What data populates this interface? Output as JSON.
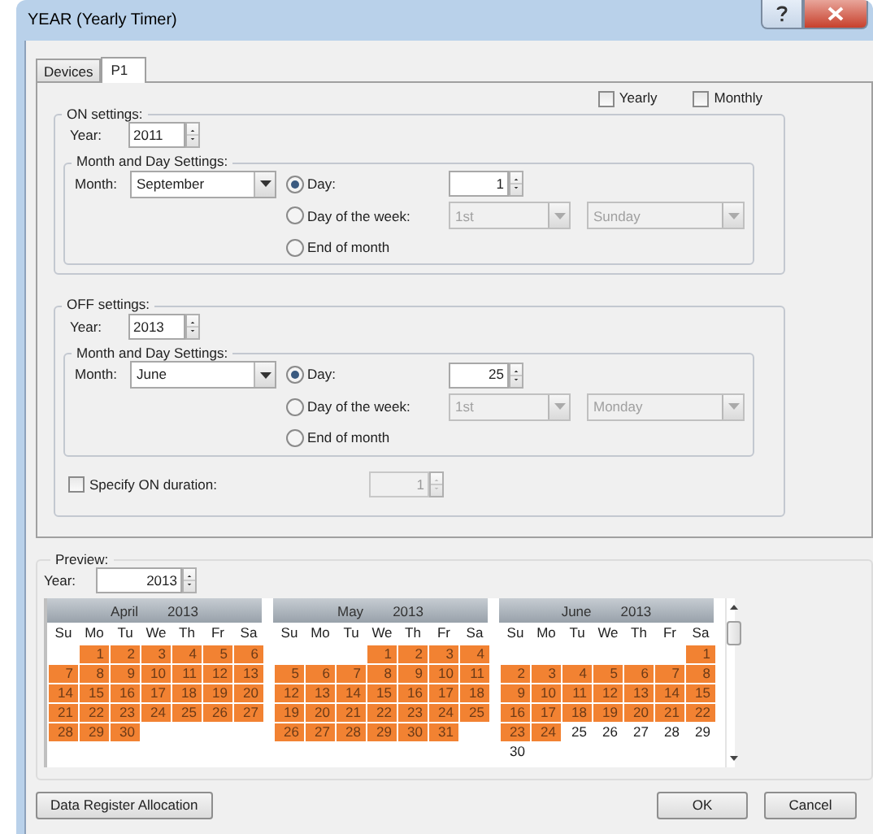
{
  "window": {
    "title": "YEAR (Yearly Timer)"
  },
  "tabs": [
    {
      "label": "Devices",
      "selected": false
    },
    {
      "label": "P1",
      "selected": true
    }
  ],
  "options": [
    {
      "label": "Yearly",
      "checked": false
    },
    {
      "label": "Monthly",
      "checked": false
    }
  ],
  "settings": [
    {
      "title": "ON settings:",
      "year_label": "Year:",
      "year": "2011",
      "group_title": "Month and Day Settings:",
      "month_label": "Month:",
      "month": "September",
      "modes": [
        {
          "label": "Day:",
          "selected": true
        },
        {
          "label": "Day of the week:",
          "selected": false
        },
        {
          "label": "End of month",
          "selected": false
        }
      ],
      "day": {
        "value": "1",
        "disabled": false
      },
      "week": {
        "value": "1st",
        "disabled": true
      },
      "weekday": {
        "value": "Sunday",
        "disabled": true
      }
    },
    {
      "title": "OFF settings:",
      "year_label": "Year:",
      "year": "2013",
      "group_title": "Month and Day Settings:",
      "month_label": "Month:",
      "month": "June",
      "modes": [
        {
          "label": "Day:",
          "selected": true
        },
        {
          "label": "Day of the week:",
          "selected": false
        },
        {
          "label": "End of month",
          "selected": false
        }
      ],
      "day": {
        "value": "25",
        "disabled": false
      },
      "week": {
        "value": "1st",
        "disabled": true
      },
      "weekday": {
        "value": "Monday",
        "disabled": true
      },
      "duration": {
        "label": "Specify ON duration:",
        "checked": false,
        "value": "1",
        "disabled": true
      }
    }
  ],
  "preview": {
    "title": "Preview:",
    "year_label": "Year:",
    "year": "2013",
    "calendars": [
      {
        "month": "April",
        "year": "2013",
        "weekdays": [
          "Su",
          "Mo",
          "Tu",
          "We",
          "Th",
          "Fr",
          "Sa"
        ],
        "weeks": [
          [
            {
              "kind": "empty"
            },
            {
              "kind": "day",
              "d": "1",
              "marked": true
            },
            {
              "d": "2",
              "marked": true
            },
            {
              "d": "3",
              "marked": true
            },
            {
              "d": "4",
              "marked": true
            },
            {
              "d": "5",
              "marked": true
            },
            {
              "d": "6",
              "marked": true
            }
          ],
          [
            {
              "d": "7",
              "marked": true
            },
            {
              "d": "8",
              "marked": true
            },
            {
              "d": "9",
              "marked": true
            },
            {
              "d": "10",
              "marked": true
            },
            {
              "d": "11",
              "marked": true
            },
            {
              "d": "12",
              "marked": true
            },
            {
              "d": "13",
              "marked": true
            }
          ],
          [
            {
              "d": "14",
              "marked": true
            },
            {
              "d": "15",
              "marked": true
            },
            {
              "d": "16",
              "marked": true
            },
            {
              "d": "17",
              "marked": true
            },
            {
              "d": "18",
              "marked": true
            },
            {
              "d": "19",
              "marked": true
            },
            {
              "d": "20",
              "marked": true
            }
          ],
          [
            {
              "d": "21",
              "marked": true
            },
            {
              "d": "22",
              "marked": true
            },
            {
              "d": "23",
              "marked": true
            },
            {
              "d": "24",
              "marked": true
            },
            {
              "d": "25",
              "marked": true
            },
            {
              "d": "26",
              "marked": true
            },
            {
              "d": "27",
              "marked": true
            }
          ],
          [
            {
              "d": "28",
              "marked": true
            },
            {
              "d": "29",
              "marked": true
            },
            {
              "d": "30",
              "marked": true
            }
          ]
        ]
      },
      {
        "month": "May",
        "year": "2013",
        "weekdays": [
          "Su",
          "Mo",
          "Tu",
          "We",
          "Th",
          "Fr",
          "Sa"
        ],
        "weeks": [
          [
            {
              "kind": "empty"
            },
            {
              "kind": "empty"
            },
            {
              "kind": "empty"
            },
            {
              "d": "1",
              "marked": true
            },
            {
              "d": "2",
              "marked": true
            },
            {
              "d": "3",
              "marked": true
            },
            {
              "d": "4",
              "marked": true
            }
          ],
          [
            {
              "d": "5",
              "marked": true
            },
            {
              "d": "6",
              "marked": true
            },
            {
              "d": "7",
              "marked": true
            },
            {
              "d": "8",
              "marked": true
            },
            {
              "d": "9",
              "marked": true
            },
            {
              "d": "10",
              "marked": true
            },
            {
              "d": "11",
              "marked": true
            }
          ],
          [
            {
              "d": "12",
              "marked": true
            },
            {
              "d": "13",
              "marked": true
            },
            {
              "d": "14",
              "marked": true
            },
            {
              "d": "15",
              "marked": true
            },
            {
              "d": "16",
              "marked": true
            },
            {
              "d": "17",
              "marked": true
            },
            {
              "d": "18",
              "marked": true
            }
          ],
          [
            {
              "d": "19",
              "marked": true
            },
            {
              "d": "20",
              "marked": true
            },
            {
              "d": "21",
              "marked": true
            },
            {
              "d": "22",
              "marked": true
            },
            {
              "d": "23",
              "marked": true
            },
            {
              "d": "24",
              "marked": true
            },
            {
              "d": "25",
              "marked": true
            }
          ],
          [
            {
              "d": "26",
              "marked": true
            },
            {
              "d": "27",
              "marked": true
            },
            {
              "d": "28",
              "marked": true
            },
            {
              "d": "29",
              "marked": true
            },
            {
              "d": "30",
              "marked": true
            },
            {
              "d": "31",
              "marked": true
            }
          ]
        ]
      },
      {
        "month": "June",
        "year": "2013",
        "weekdays": [
          "Su",
          "Mo",
          "Tu",
          "We",
          "Th",
          "Fr",
          "Sa"
        ],
        "weeks": [
          [
            {
              "kind": "empty"
            },
            {
              "kind": "empty"
            },
            {
              "kind": "empty"
            },
            {
              "kind": "empty"
            },
            {
              "kind": "empty"
            },
            {
              "kind": "empty"
            },
            {
              "d": "1",
              "marked": true
            }
          ],
          [
            {
              "d": "2",
              "marked": true
            },
            {
              "d": "3",
              "marked": true
            },
            {
              "d": "4",
              "marked": true
            },
            {
              "d": "5",
              "marked": true
            },
            {
              "d": "6",
              "marked": true
            },
            {
              "d": "7",
              "marked": true
            },
            {
              "d": "8",
              "marked": true
            }
          ],
          [
            {
              "d": "9",
              "marked": true
            },
            {
              "d": "10",
              "marked": true
            },
            {
              "d": "11",
              "marked": true
            },
            {
              "d": "12",
              "marked": true
            },
            {
              "d": "13",
              "marked": true
            },
            {
              "d": "14",
              "marked": true
            },
            {
              "d": "15",
              "marked": true
            }
          ],
          [
            {
              "d": "16",
              "marked": true
            },
            {
              "d": "17",
              "marked": true
            },
            {
              "d": "18",
              "marked": true
            },
            {
              "d": "19",
              "marked": true
            },
            {
              "d": "20",
              "marked": true
            },
            {
              "d": "21",
              "marked": true
            },
            {
              "d": "22",
              "marked": true
            }
          ],
          [
            {
              "d": "23",
              "marked": true
            },
            {
              "d": "24",
              "marked": true
            },
            {
              "d": "25",
              "marked": false
            },
            {
              "d": "26",
              "marked": false
            },
            {
              "d": "27",
              "marked": false
            },
            {
              "d": "28",
              "marked": false
            },
            {
              "d": "29",
              "marked": false
            }
          ],
          [
            {
              "d": "30",
              "marked": false
            }
          ]
        ]
      }
    ]
  },
  "buttons": [
    {
      "label": "Data Register Allocation"
    },
    {
      "label": "OK"
    },
    {
      "label": "Cancel"
    }
  ]
}
